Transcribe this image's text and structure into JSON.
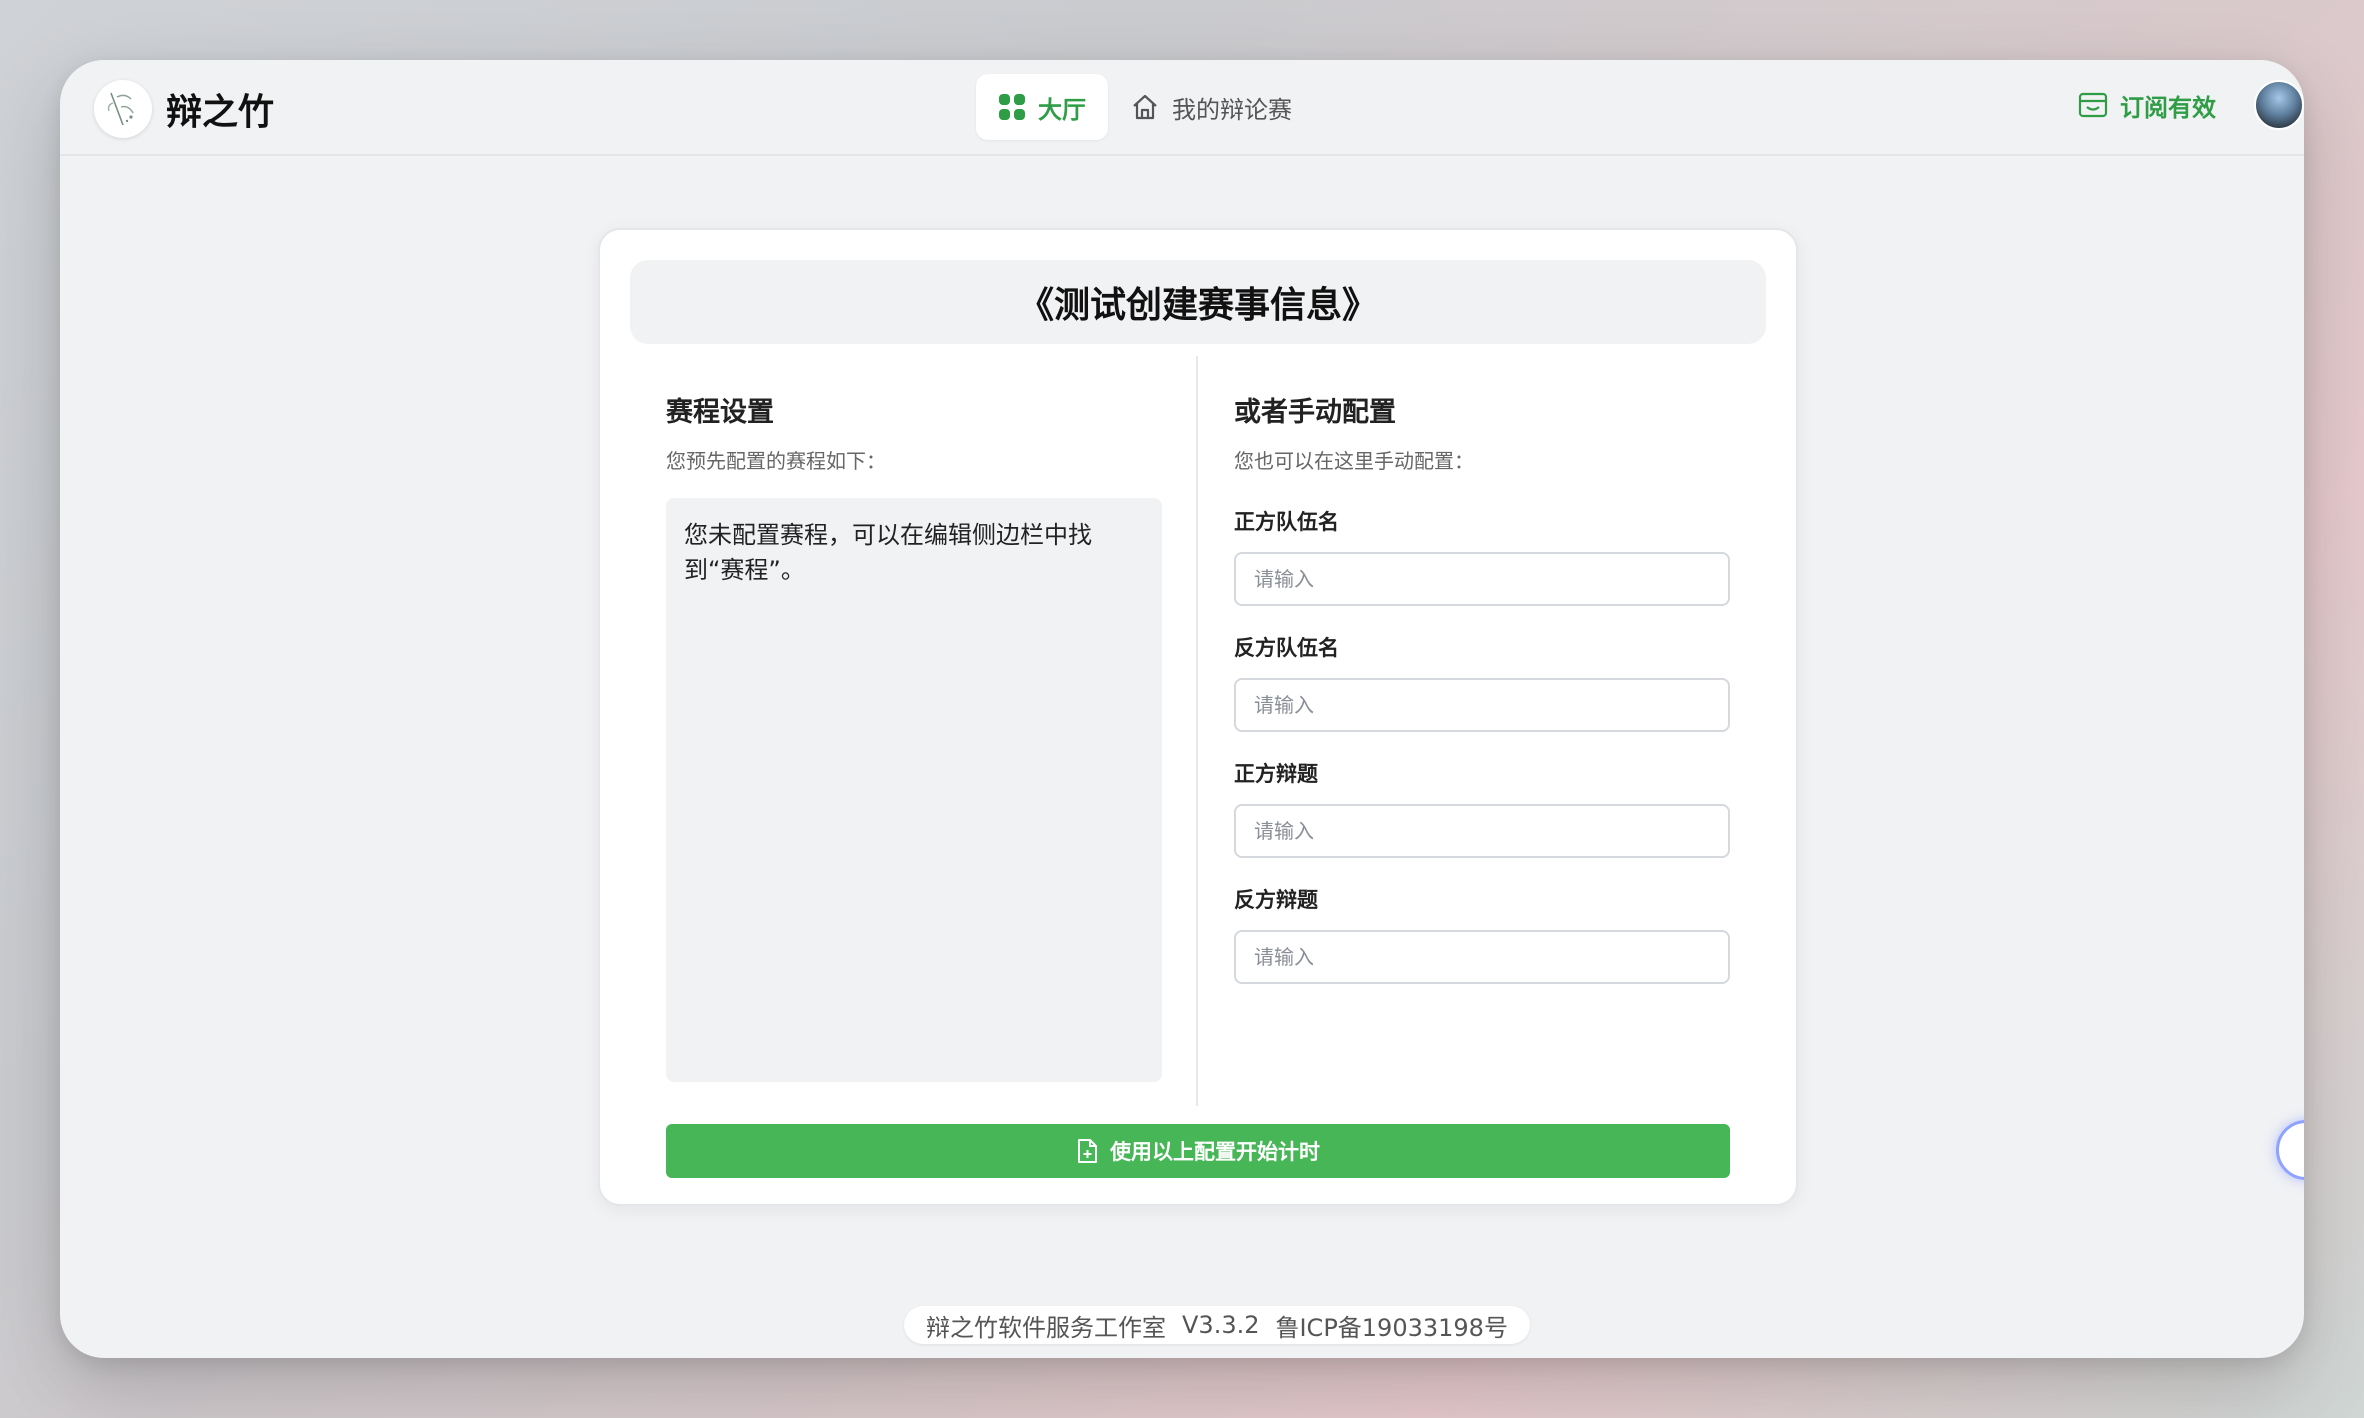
{
  "app": {
    "name": "辩之竹",
    "logo": "bamboo-logo-icon"
  },
  "nav": {
    "tabs": [
      {
        "label": "大厅",
        "icon": "grid-icon",
        "active": true
      },
      {
        "label": "我的辩论赛",
        "icon": "home-icon",
        "active": false
      }
    ],
    "subscription": {
      "label": "订阅有效",
      "icon": "wallet-icon"
    }
  },
  "colors": {
    "accent": "#46b656",
    "accent_text": "#2e9d46",
    "page_bg": "#f1f2f4"
  },
  "card": {
    "title": "《测试创建赛事信息》",
    "schedule": {
      "title": "赛程设置",
      "subtitle": "您预先配置的赛程如下：",
      "empty_message": "您未配置赛程，可以在编辑侧边栏中找到“赛程”。"
    },
    "manual": {
      "title": "或者手动配置",
      "subtitle": "您也可以在这里手动配置：",
      "fields": [
        {
          "label": "正方队伍名",
          "placeholder": "请输入",
          "value": ""
        },
        {
          "label": "反方队伍名",
          "placeholder": "请输入",
          "value": ""
        },
        {
          "label": "正方辩题",
          "placeholder": "请输入",
          "value": ""
        },
        {
          "label": "反方辩题",
          "placeholder": "请输入",
          "value": ""
        }
      ]
    },
    "start_button": "使用以上配置开始计时"
  },
  "footer": {
    "studio": "辩之竹软件服务工作室",
    "version": "V3.3.2",
    "icp": "鲁ICP备19033198号"
  }
}
